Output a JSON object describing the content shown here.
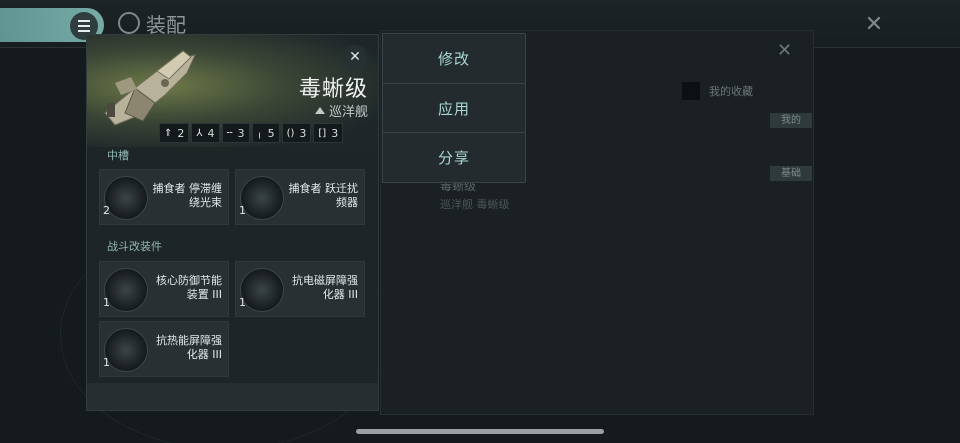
{
  "background": {
    "screen_title": "装配",
    "close_label": "✕",
    "panel_close_label": "✕",
    "favorites_label": "我的收藏",
    "tag_mine": "我的",
    "tag_basic": "基础",
    "ship_name": "毒蜥级",
    "ship_subtitle": "巡洋舰 毒蜥级"
  },
  "context_menu": {
    "items": [
      "修改",
      "应用",
      "分享"
    ]
  },
  "fitting": {
    "ship_name": "毒蜥级",
    "ship_class": "巡洋舰",
    "close_label": "✕",
    "slots": [
      {
        "icon": "high-slot-icon",
        "glyph": "⇑",
        "value": "2"
      },
      {
        "icon": "turret-icon",
        "glyph": "⅄",
        "value": "4"
      },
      {
        "icon": "mid-slot-icon",
        "glyph": "╌",
        "value": "3"
      },
      {
        "icon": "low-slot-icon",
        "glyph": "╷",
        "value": "5"
      },
      {
        "icon": "rig-icon",
        "glyph": "()",
        "value": "3"
      },
      {
        "icon": "subsystem-icon",
        "glyph": "[]",
        "value": "3"
      }
    ],
    "section_mid": "中槽",
    "section_combat_mods": "战斗改装件",
    "modules": {
      "mid": [
        {
          "name": "捕食者 停滞缠绕光束",
          "count": "2",
          "icon": "stasis-web-icon"
        },
        {
          "name": "捕食者 跃迁扰频器",
          "count": "1",
          "icon": "warp-scrambler-icon"
        }
      ],
      "rigs": [
        {
          "name": "核心防御节能装置 III",
          "count": "1",
          "icon": "rig-module-icon"
        },
        {
          "name": "抗电磁屏障强化器 III",
          "count": "1",
          "icon": "rig-module-icon"
        },
        {
          "name": "抗热能屏障强化器 III",
          "count": "1",
          "icon": "rig-module-icon"
        }
      ]
    }
  }
}
